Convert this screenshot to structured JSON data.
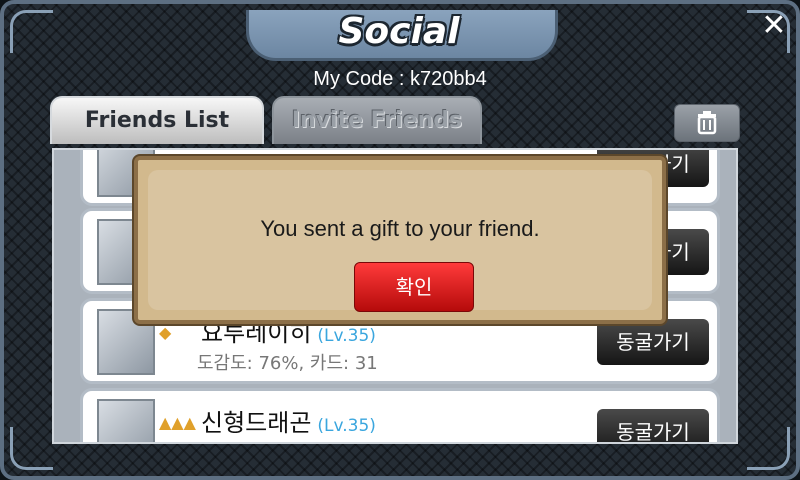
{
  "header": {
    "title": "Social",
    "close_icon": "close-icon",
    "my_code": "My Code : k720bb4"
  },
  "tabs": [
    {
      "label": "Friends List",
      "active": true
    },
    {
      "label": "Invite Friends",
      "active": false
    }
  ],
  "toolbar": {
    "trash_icon": "trash-icon"
  },
  "friends": [
    {
      "name": "",
      "level": "",
      "stats": "",
      "action": "동굴가기"
    },
    {
      "name": "",
      "level": "",
      "stats": "",
      "action": "동굴가기"
    },
    {
      "name": "요루레이히",
      "level": "(Lv.35)",
      "stats": "도감도: 76%, 카드: 31",
      "action": "동굴가기",
      "rank_icon": "diamond-icon"
    },
    {
      "name": "신형드래곤",
      "level": "(Lv.35)",
      "stats": "",
      "action": "동굴가기",
      "rank_icon": "crown-icon"
    }
  ],
  "dialog": {
    "message": "You sent a gift to your friend.",
    "ok_label": "확인"
  },
  "colors": {
    "frame": "#252d35",
    "accent_blue": "#3aa6de",
    "ok_red": "#d61a1a"
  }
}
